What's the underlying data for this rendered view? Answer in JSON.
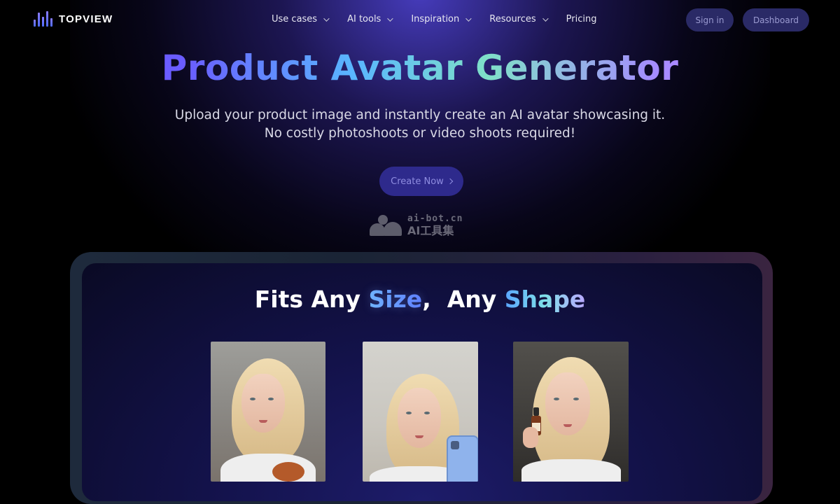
{
  "brand": {
    "name": "TOPVIEW"
  },
  "nav": {
    "items": [
      {
        "label": "Use cases",
        "has_dropdown": true
      },
      {
        "label": "AI tools",
        "has_dropdown": true
      },
      {
        "label": "Inspiration",
        "has_dropdown": true
      },
      {
        "label": "Resources",
        "has_dropdown": true
      },
      {
        "label": "Pricing",
        "has_dropdown": false
      }
    ],
    "sign_in": "Sign in",
    "dashboard": "Dashboard"
  },
  "hero": {
    "title": "Product Avatar Generator",
    "subtitle_line1": "Upload your product image and instantly create an AI avatar showcasing it.",
    "subtitle_line2": "No costly photoshoots or video shoots required!",
    "cta": "Create Now"
  },
  "watermark": {
    "line1": "ai-bot.cn",
    "line2": "AI工具集"
  },
  "showcase": {
    "title_part1": "Fits Any ",
    "title_highlight1": "Size",
    "title_part2": ",  Any ",
    "title_highlight2": "Shape",
    "cards": [
      {
        "name": "avatar-holding-item",
        "prop": "bowl"
      },
      {
        "name": "avatar-holding-phone",
        "prop": "phone"
      },
      {
        "name": "avatar-holding-bottle",
        "prop": "bottle"
      }
    ]
  },
  "colors": {
    "background": "#000000",
    "button_bg": "#2a2a66",
    "cta_bg": "#2e2a8c",
    "accent_purple": "#6a5cff",
    "accent_teal": "#7fe0c8"
  }
}
